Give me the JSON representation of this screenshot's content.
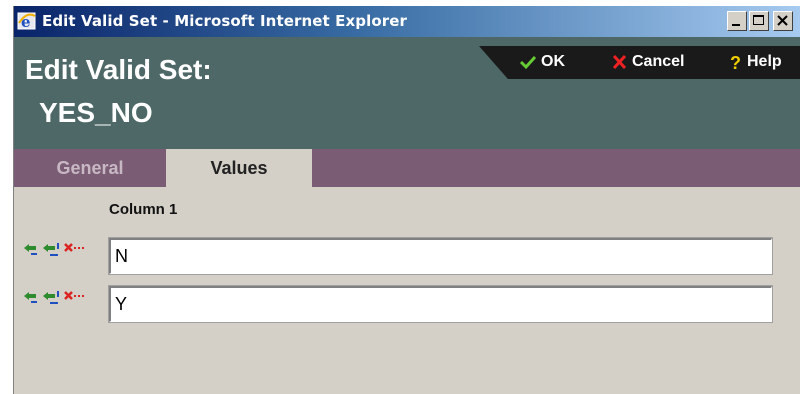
{
  "window": {
    "title": "Edit Valid Set - Microsoft Internet Explorer",
    "icon": "ie-icon",
    "controls": [
      "minimize-icon",
      "maximize-icon",
      "close-icon"
    ]
  },
  "header": {
    "title": "Edit Valid Set:",
    "subtitle": "YES_NO",
    "background_color": "#4e6868"
  },
  "toolbar": {
    "ok_label": "OK",
    "cancel_label": "Cancel",
    "help_label": "Help",
    "ok_icon": "checkmark-icon",
    "cancel_icon": "x-icon",
    "help_icon": "question-icon"
  },
  "tabs": [
    {
      "label": "General",
      "active": false
    },
    {
      "label": "Values",
      "active": true
    }
  ],
  "values_table": {
    "column_header": "Column 1",
    "row_actions": [
      "insert-before-icon",
      "insert-after-icon",
      "delete-row-icon"
    ],
    "rows": [
      {
        "value": "N"
      },
      {
        "value": "Y"
      }
    ]
  }
}
